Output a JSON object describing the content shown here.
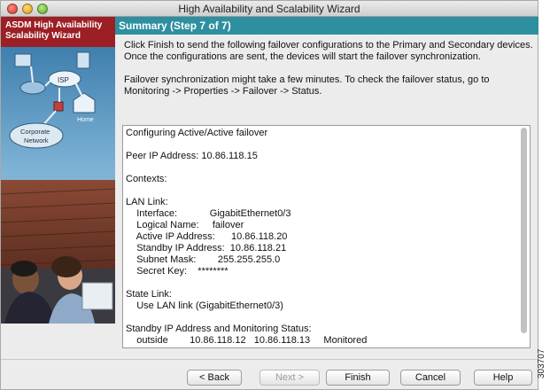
{
  "window": {
    "title": "High Availability and Scalability Wizard"
  },
  "sidebar": {
    "header_line1": "ASDM High Availability",
    "header_line2": "Scalability Wizard",
    "art_labels": {
      "isp": "ISP",
      "home": "Home",
      "corporate_line1": "Corporate",
      "corporate_line2": "Network"
    }
  },
  "step": {
    "title": "Summary (Step 7 of 7)"
  },
  "intro": {
    "paragraph1": "Click Finish to send the following failover configurations to the Primary and Secondary devices. Once the configurations are sent, the devices will start the failover synchronization.",
    "paragraph2": "Failover synchronization might take a few minutes. To check the failover status, go to Monitoring -> Properties -> Failover -> Status."
  },
  "summary_lines": [
    "Configuring Active/Active failover",
    "",
    "Peer IP Address: 10.86.118.15",
    "",
    "Contexts:",
    "",
    "LAN Link:",
    "    Interface:            GigabitEthernet0/3",
    "    Logical Name:     failover",
    "    Active IP Address:      10.86.118.20",
    "    Standby IP Address:  10.86.118.21",
    "    Subnet Mask:        255.255.255.0",
    "    Secret Key:    ********",
    "",
    "State Link:",
    "    Use LAN link (GigabitEthernet0/3)",
    "",
    "Standby IP Address and Monitoring Status:",
    "    outside        10.86.118.12   10.86.118.13     Monitored"
  ],
  "buttons": {
    "back": "< Back",
    "next": "Next >",
    "finish": "Finish",
    "cancel": "Cancel",
    "help": "Help"
  },
  "figure_id": "303707"
}
